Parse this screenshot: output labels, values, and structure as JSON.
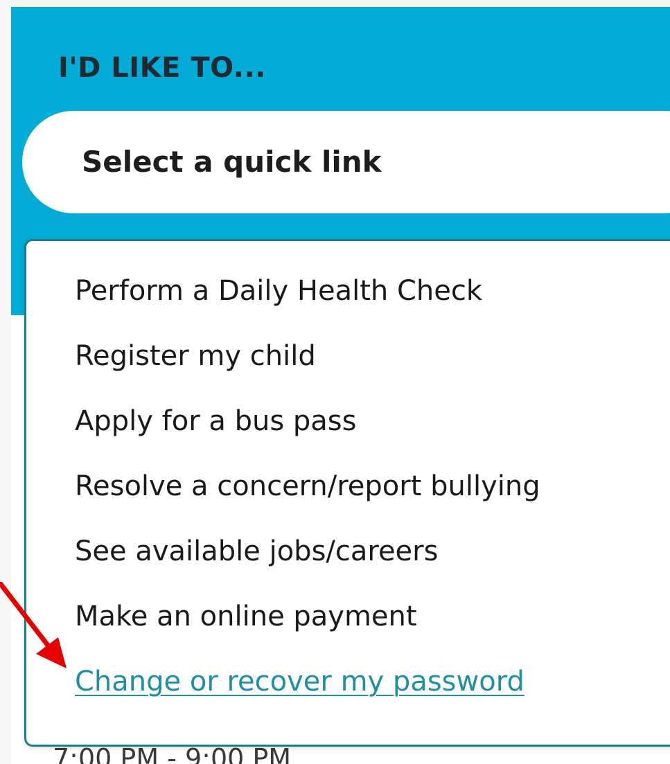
{
  "panel": {
    "heading": "I'D LIKE TO...",
    "select_value": "Select a quick link",
    "accent_color": "#04abd6"
  },
  "dropdown": {
    "items": [
      {
        "label": "Perform a Daily Health Check"
      },
      {
        "label": "Register my child"
      },
      {
        "label": "Apply for a bus pass"
      },
      {
        "label": "Resolve a concern/report bullying"
      },
      {
        "label": "See available jobs/careers"
      },
      {
        "label": "Make an online payment"
      },
      {
        "label": "Change or recover my password"
      }
    ],
    "highlighted_index": 6,
    "border_color": "#1d7f8c",
    "link_color": "#1f8fa3"
  },
  "background": {
    "partial_time_text": "7:00 PM - 9:00 PM"
  },
  "annotation": {
    "icon": "red-arrow-icon",
    "color": "#e60000"
  }
}
